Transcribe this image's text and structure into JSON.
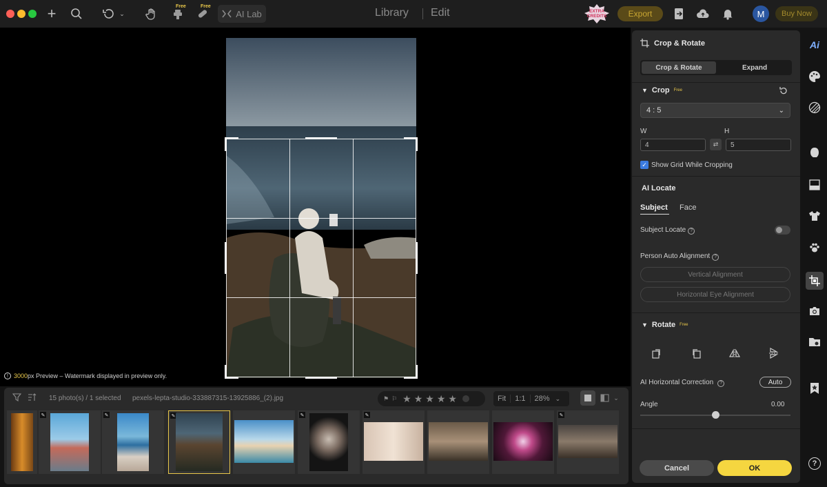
{
  "titlebar": {
    "ai_lab_label": "AI Lab",
    "free_tag": "Free",
    "tabs": [
      "Library",
      "Edit"
    ],
    "extra_credits": [
      "EXTRA",
      "CREDITS"
    ],
    "export_label": "Export",
    "avatar_initial": "M",
    "buy_now_label": "Buy Now"
  },
  "canvas": {
    "preview_px": "3000",
    "preview_text": "px Preview – Watermark displayed in preview only."
  },
  "filmstrip": {
    "count_text": "15 photo(s) / 1 selected",
    "filename": "pexels-lepta-studio-333887315-13925886_(2).jpg",
    "zoom_fit": "Fit",
    "zoom_1to1": "1:1",
    "zoom_pct": "28%",
    "stars": [
      "★",
      "★",
      "★",
      "★",
      "★"
    ],
    "edit_badge": "✎"
  },
  "panel": {
    "title": "Crop & Rotate",
    "tabs": [
      "Crop & Rotate",
      "Expand"
    ],
    "crop_label": "Crop",
    "free_tag": "Free",
    "ratio_value": "4 : 5",
    "w_label": "W",
    "h_label": "H",
    "w_value": "4",
    "h_value": "5",
    "show_grid_label": "Show Grid While Cropping",
    "ai_locate_label": "AI Locate",
    "locate_tabs": [
      "Subject",
      "Face"
    ],
    "subject_locate_label": "Subject Locate",
    "person_align_label": "Person Auto Alignment",
    "vertical_align_label": "Vertical Alignment",
    "horizontal_eye_label": "Horizontal Eye Alignment",
    "rotate_label": "Rotate",
    "ai_horizontal_label": "AI Horizontal Correction",
    "auto_label": "Auto",
    "angle_label": "Angle",
    "angle_value": "0.00",
    "angle_level": 0.5,
    "cancel_label": "Cancel",
    "ok_label": "OK"
  },
  "rail": {
    "ai_label": "Ai"
  },
  "colors": {
    "accent": "#f5d640",
    "checkbox": "#3b7be0",
    "avatar": "#2a56a0"
  }
}
